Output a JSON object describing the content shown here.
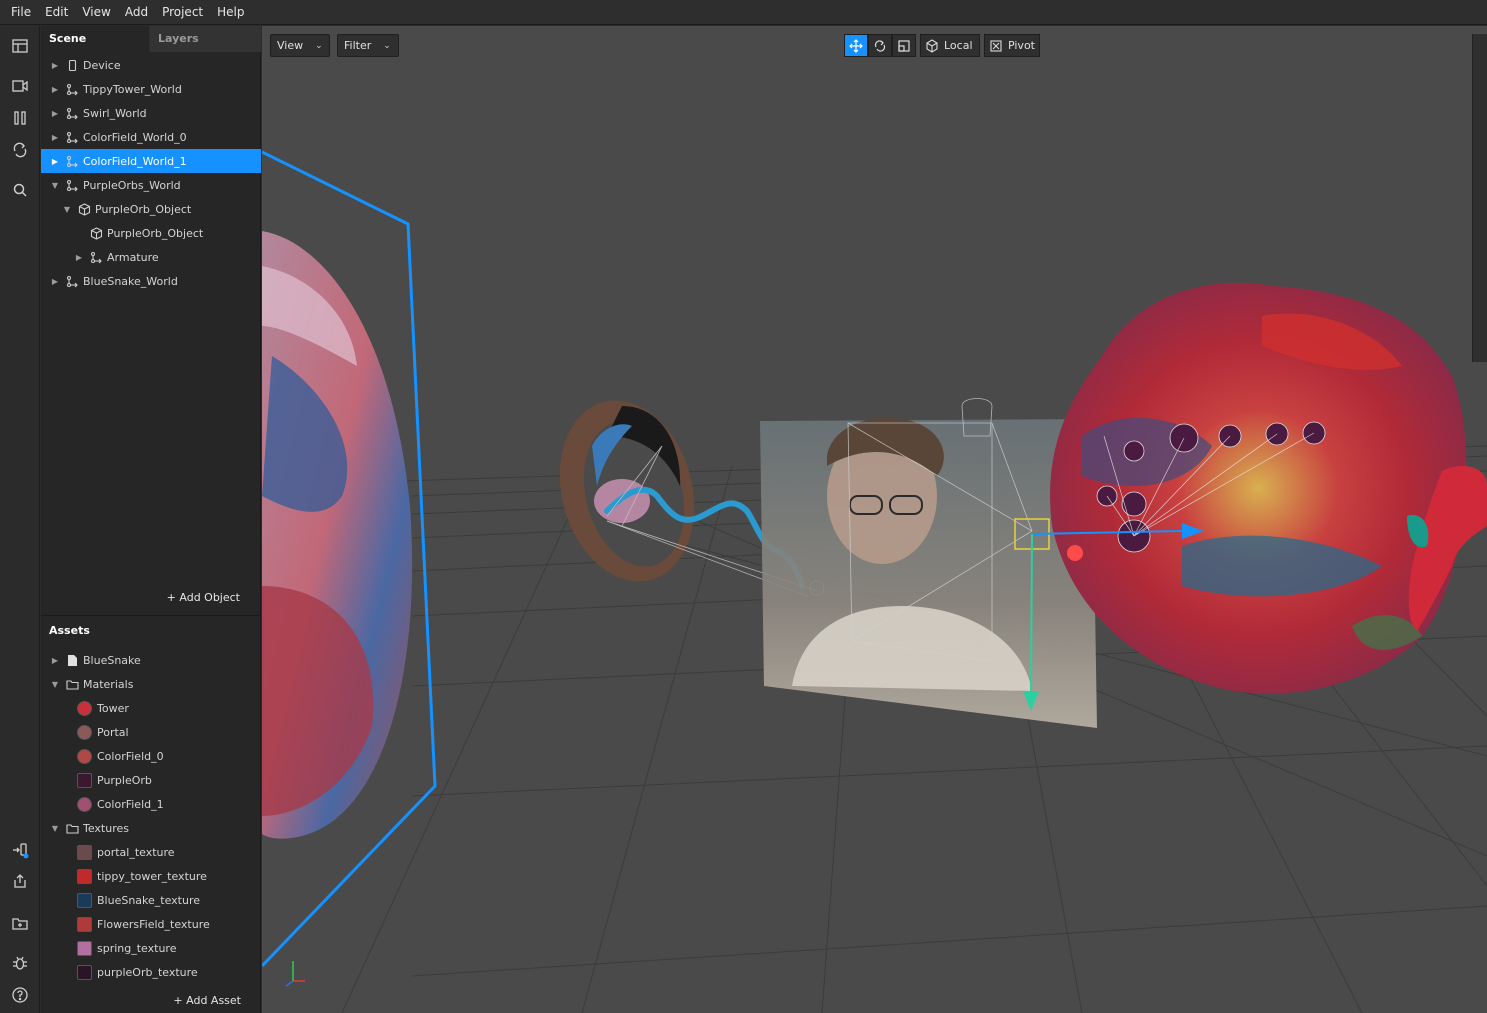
{
  "menu": [
    "File",
    "Edit",
    "View",
    "Add",
    "Project",
    "Help"
  ],
  "scene_panel": {
    "tabs": {
      "scene": "Scene",
      "layers": "Layers"
    },
    "items": [
      {
        "label": "Device",
        "icon": "device-icon",
        "expanded": false,
        "depth": 0
      },
      {
        "label": "TippyTower_World",
        "icon": "transform-icon",
        "expanded": false,
        "depth": 0
      },
      {
        "label": "Swirl_World",
        "icon": "transform-icon",
        "expanded": false,
        "depth": 0
      },
      {
        "label": "ColorField_World_0",
        "icon": "transform-icon",
        "expanded": false,
        "depth": 0
      },
      {
        "label": "ColorField_World_1",
        "icon": "transform-icon",
        "expanded": false,
        "depth": 0,
        "selected": true
      },
      {
        "label": "PurpleOrbs_World",
        "icon": "transform-icon",
        "expanded": true,
        "depth": 0
      },
      {
        "label": "PurpleOrb_Object",
        "icon": "cube-icon",
        "expanded": true,
        "depth": 1
      },
      {
        "label": "PurpleOrb_Object",
        "icon": "cube-icon",
        "expanded": false,
        "depth": 2
      },
      {
        "label": "Armature",
        "icon": "transform-icon",
        "expanded": false,
        "depth": 2
      },
      {
        "label": "BlueSnake_World",
        "icon": "transform-icon",
        "expanded": false,
        "depth": 0
      }
    ],
    "add_object": "Add Object"
  },
  "assets_panel": {
    "title": "Assets",
    "items": [
      {
        "label": "BlueSnake",
        "kind": "file"
      },
      {
        "label": "Materials",
        "kind": "folder"
      },
      {
        "label": "Tower",
        "kind": "material",
        "color": "#c8303a"
      },
      {
        "label": "Portal",
        "kind": "material",
        "color": "#8a5a5a"
      },
      {
        "label": "ColorField_0",
        "kind": "material",
        "color": "#b04848"
      },
      {
        "label": "PurpleOrb",
        "kind": "material-sq",
        "color": "#3a1830"
      },
      {
        "label": "ColorField_1",
        "kind": "material",
        "color": "#a05070"
      },
      {
        "label": "Textures",
        "kind": "folder"
      },
      {
        "label": "portal_texture",
        "kind": "texture",
        "color": "#6a4a4a"
      },
      {
        "label": "tippy_tower_texture",
        "kind": "texture",
        "color": "#c02a2a"
      },
      {
        "label": "BlueSnake_texture",
        "kind": "texture",
        "color": "#1a3a5a"
      },
      {
        "label": "FlowersField_texture",
        "kind": "texture",
        "color": "#b03a3a"
      },
      {
        "label": "spring_texture",
        "kind": "texture",
        "color": "#b070a0"
      },
      {
        "label": "purpleOrb_texture",
        "kind": "texture",
        "color": "#2a1426"
      }
    ],
    "add_asset": "Add Asset"
  },
  "viewport": {
    "view_label": "View",
    "filter_label": "Filter",
    "local_label": "Local",
    "pivot_label": "Pivot",
    "selection_color": "#1592ff"
  }
}
